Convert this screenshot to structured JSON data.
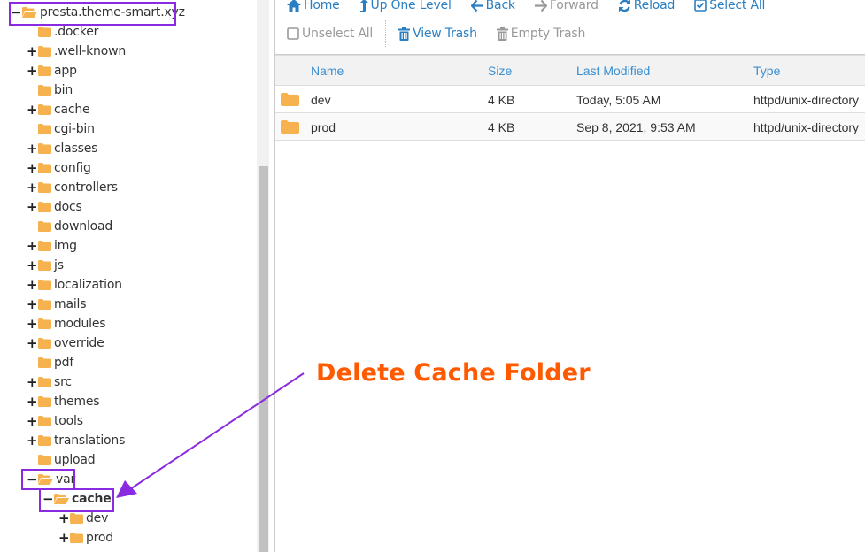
{
  "tree": {
    "root": {
      "label": "presta.theme-smart.xyz",
      "toggle": "−",
      "expanded": true
    },
    "items": [
      {
        "label": ".docker",
        "toggle": "",
        "depth": 1
      },
      {
        "label": ".well-known",
        "toggle": "+",
        "depth": 1
      },
      {
        "label": "app",
        "toggle": "+",
        "depth": 1
      },
      {
        "label": "bin",
        "toggle": "",
        "depth": 1
      },
      {
        "label": "cache",
        "toggle": "+",
        "depth": 1
      },
      {
        "label": "cgi-bin",
        "toggle": "",
        "depth": 1
      },
      {
        "label": "classes",
        "toggle": "+",
        "depth": 1
      },
      {
        "label": "config",
        "toggle": "+",
        "depth": 1
      },
      {
        "label": "controllers",
        "toggle": "+",
        "depth": 1
      },
      {
        "label": "docs",
        "toggle": "+",
        "depth": 1
      },
      {
        "label": "download",
        "toggle": "",
        "depth": 1
      },
      {
        "label": "img",
        "toggle": "+",
        "depth": 1
      },
      {
        "label": "js",
        "toggle": "+",
        "depth": 1
      },
      {
        "label": "localization",
        "toggle": "+",
        "depth": 1
      },
      {
        "label": "mails",
        "toggle": "+",
        "depth": 1
      },
      {
        "label": "modules",
        "toggle": "+",
        "depth": 1
      },
      {
        "label": "override",
        "toggle": "+",
        "depth": 1
      },
      {
        "label": "pdf",
        "toggle": "",
        "depth": 1
      },
      {
        "label": "src",
        "toggle": "+",
        "depth": 1
      },
      {
        "label": "themes",
        "toggle": "+",
        "depth": 1
      },
      {
        "label": "tools",
        "toggle": "+",
        "depth": 1
      },
      {
        "label": "translations",
        "toggle": "+",
        "depth": 1
      },
      {
        "label": "upload",
        "toggle": "",
        "depth": 1
      },
      {
        "label": "var",
        "toggle": "−",
        "depth": 1,
        "expanded": true
      },
      {
        "label": "cache",
        "toggle": "−",
        "depth": 2,
        "expanded": true,
        "selected": true
      },
      {
        "label": "dev",
        "toggle": "+",
        "depth": 3
      },
      {
        "label": "prod",
        "toggle": "+",
        "depth": 3
      }
    ]
  },
  "toolbar": {
    "row1": [
      {
        "label": "Home",
        "icon": "home-icon",
        "state": "active"
      },
      {
        "label": "Up One Level",
        "icon": "level-up-icon",
        "state": "active"
      },
      {
        "label": "Back",
        "icon": "arrow-left-icon",
        "state": "active"
      },
      {
        "label": "Forward",
        "icon": "arrow-right-icon",
        "state": "disabled"
      },
      {
        "label": "Reload",
        "icon": "reload-icon",
        "state": "active"
      },
      {
        "label": "Select All",
        "icon": "checkbox-checked-icon",
        "state": "active"
      }
    ],
    "row2": [
      {
        "label": "Unselect All",
        "icon": "checkbox-empty-icon",
        "state": "disabled"
      },
      {
        "label": "View Trash",
        "icon": "trash-icon",
        "state": "active"
      },
      {
        "label": "Empty Trash",
        "icon": "trash-icon",
        "state": "disabled"
      }
    ]
  },
  "table": {
    "columns": [
      "Name",
      "Size",
      "Last Modified",
      "Type"
    ],
    "rows": [
      {
        "name": "dev",
        "size": "4 KB",
        "modified": "Today, 5:05 AM",
        "type": "httpd/unix-directory"
      },
      {
        "name": "prod",
        "size": "4 KB",
        "modified": "Sep 8, 2021, 9:53 AM",
        "type": "httpd/unix-directory"
      }
    ]
  },
  "annotation": {
    "text": "Delete Cache Folder",
    "text_color": "#ff5a00",
    "highlight_color": "#8a2be2"
  },
  "colors": {
    "folder": "#f6b24f",
    "link": "#2a7ec2",
    "disabled": "#999999"
  }
}
